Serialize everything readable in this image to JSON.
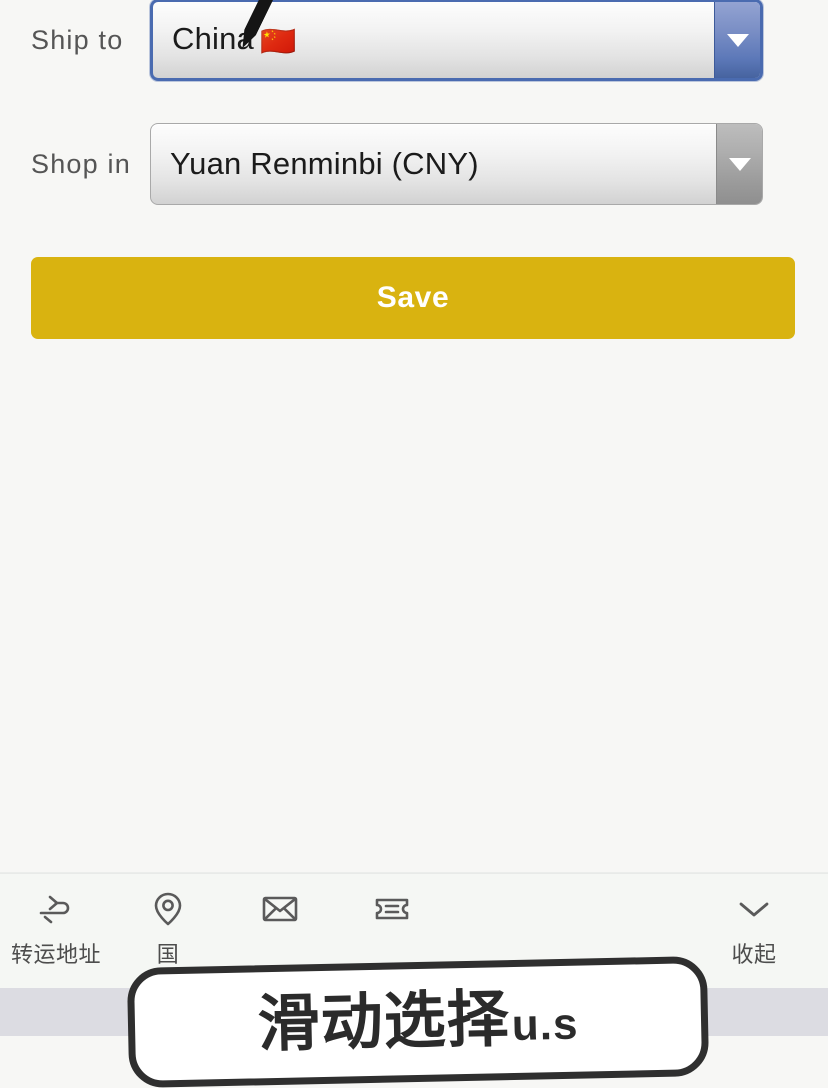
{
  "form": {
    "rows": [
      {
        "label": "Ship to",
        "value": "China",
        "flag": "🇨🇳",
        "state": "focused",
        "arrow_icon": "chevron-down-icon",
        "accent": "#4a6bb0"
      },
      {
        "label": "Shop in",
        "value": "Yuan Renminbi (CNY)",
        "flag": "",
        "state": "default",
        "arrow_icon": "chevron-down-icon",
        "accent": "#9a9a9a"
      }
    ],
    "save_label": "Save",
    "save_color": "#d9b310"
  },
  "toolbar": {
    "items": [
      {
        "icon": "airplane-icon",
        "label": "转运地址"
      },
      {
        "icon": "location-pin-icon",
        "label": "国"
      },
      {
        "icon": "envelope-icon",
        "label": ""
      },
      {
        "icon": "ticket-icon",
        "label": ""
      }
    ],
    "collapse": {
      "icon": "chevron-down-icon",
      "label": "收起"
    }
  },
  "overlay": {
    "text": "滑动选择",
    "suffix": "u.s"
  }
}
